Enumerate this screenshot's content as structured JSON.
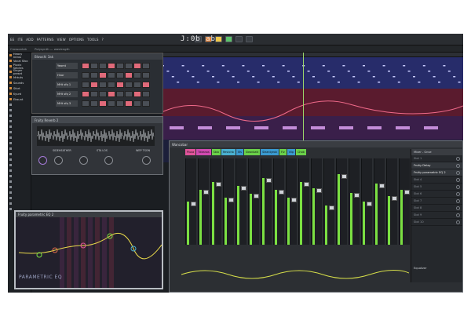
{
  "menubar": {
    "items": [
      "EE",
      "ITE",
      "ADD",
      "PATTERNS",
      "VIEW",
      "OPTIONS",
      "TOOLS",
      "?"
    ],
    "tempo": "J:0b ab"
  },
  "hint": {
    "left": "Crossontek",
    "center": "Polysynth — wavlength"
  },
  "browser": {
    "items": [
      "Heavy Intros",
      "Vocal Sfox",
      "Pluxix Selctes",
      "Singer preset",
      "Mrkuts",
      "Sounds",
      "Sfort",
      "Kyurd",
      "Ebsunt"
    ]
  },
  "channel_rack": {
    "title": "Blowchi 3ak",
    "rows": [
      "Yeamt",
      "Hnor",
      "MHt sfq 1",
      "MHt sfq 2",
      "MHt sfq 3"
    ]
  },
  "fx1": {
    "title": "Fruity Reverb 2",
    "labels": [
      "SIDEHEATHER",
      "STA LOS",
      "WEP TSON"
    ]
  },
  "eq": {
    "title": "Fruity parametric EQ 2",
    "brand": "PARAMETRIC EQ"
  },
  "mixer": {
    "title": "Wancobar",
    "tabs": [
      {
        "label": "Pluxa",
        "color": "#e0549a"
      },
      {
        "label": "Tdeanos",
        "color": "#d04ab0"
      },
      {
        "label": "Sblo",
        "color": "#6ad04a"
      },
      {
        "label": "Revtchb",
        "color": "#4ab0d0"
      },
      {
        "label": "Sfs",
        "color": "#3a9ad0"
      },
      {
        "label": "Sleanbatt",
        "color": "#6ad04a"
      },
      {
        "label": "Sleantyeok",
        "color": "#3a9ad0"
      },
      {
        "label": "Fiv",
        "color": "#6ad04a"
      },
      {
        "label": "Vlip",
        "color": "#3a9ad0"
      },
      {
        "label": "Chob",
        "color": "#6ad04a"
      }
    ],
    "levels": [
      0.55,
      0.7,
      0.8,
      0.6,
      0.75,
      0.65,
      0.85,
      0.7,
      0.6,
      0.8,
      0.72,
      0.5,
      0.9,
      0.66,
      0.55,
      0.78,
      0.62,
      0.7
    ],
    "inserts_title": "Mixer - Gnse",
    "inserts": [
      "Slot 1",
      "Fruity Delay",
      "Fruity parametric EQ 2",
      "Slot 4",
      "Slot 5",
      "Slot 6",
      "Slot 7",
      "Slot 8",
      "Slot 9",
      "Slot 10"
    ],
    "active_inserts": [
      1,
      2
    ],
    "footer": "Equalizer"
  },
  "colors": {
    "accent": "#7be042",
    "playhead": "#9bd66a"
  }
}
